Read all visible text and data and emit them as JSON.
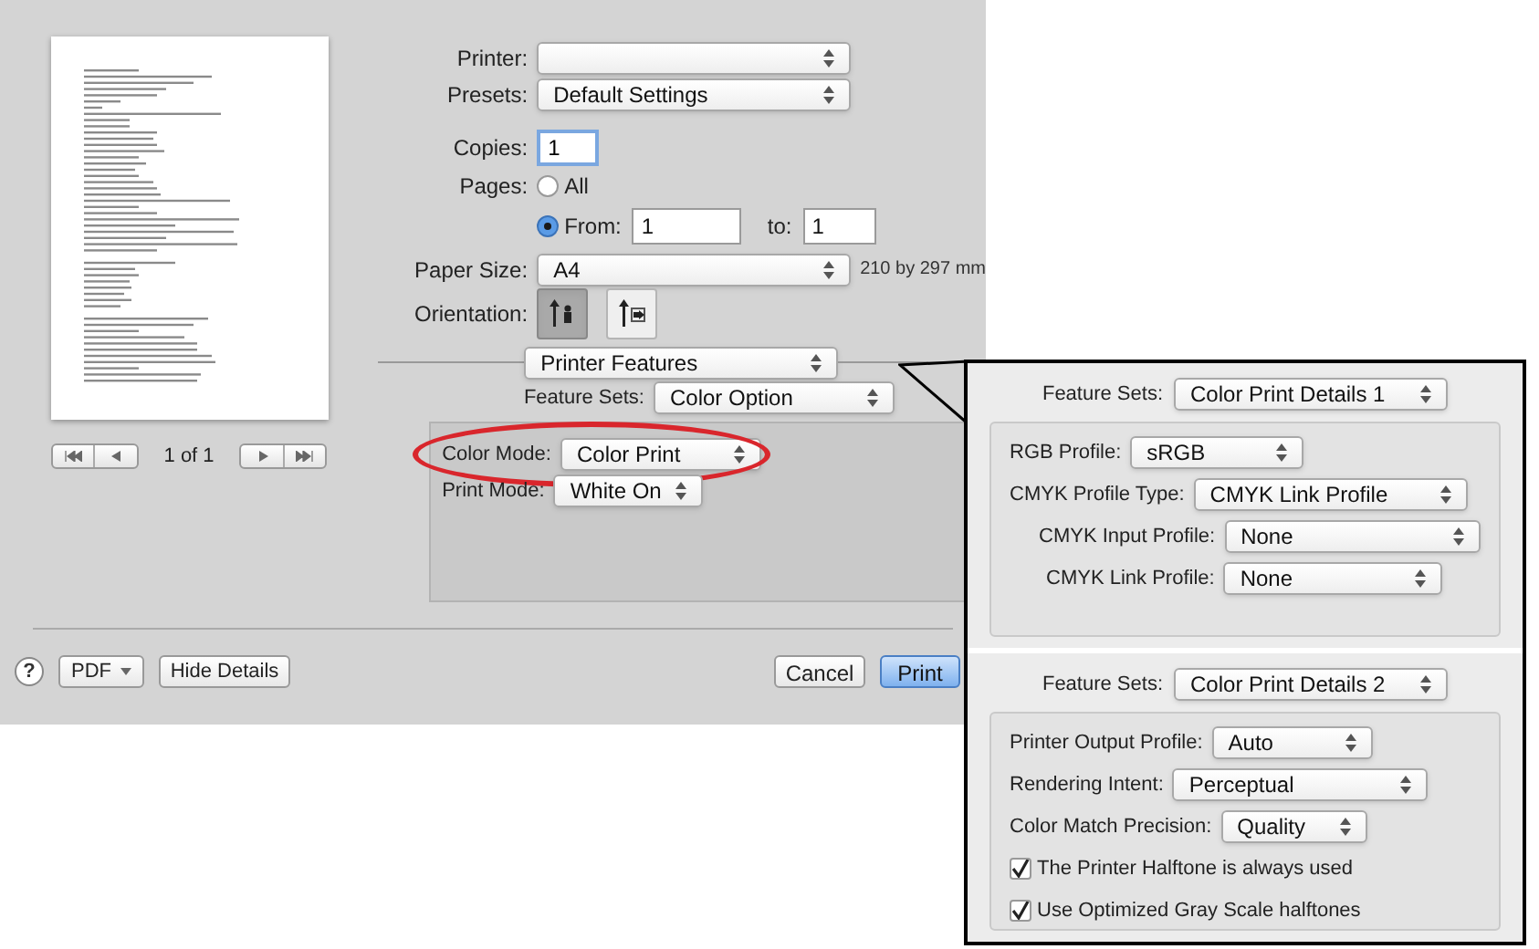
{
  "preview": {
    "page_indicator": "1 of 1"
  },
  "printer": {
    "label": "Printer:"
  },
  "presets": {
    "label": "Presets:",
    "value": "Default Settings"
  },
  "copies": {
    "label": "Copies:",
    "value": "1"
  },
  "pages": {
    "label": "Pages:",
    "options": [
      {
        "label": "All",
        "selected": false
      },
      {
        "label": "From:",
        "selected": true
      }
    ],
    "from": "1",
    "to_label": "to:",
    "to": "1"
  },
  "paper_size": {
    "label": "Paper Size:",
    "value": "A4",
    "dimensions": "210 by 297 mm"
  },
  "orientation": {
    "label": "Orientation:",
    "options": [
      {
        "kind": "portrait",
        "selected": true
      },
      {
        "kind": "landscape",
        "selected": false
      }
    ]
  },
  "panel_menu": {
    "value": "Printer Features"
  },
  "feature_sets": {
    "label": "Feature Sets:",
    "value": "Color Option"
  },
  "settings": [
    {
      "label": "Color Mode:",
      "value": "Color Print",
      "highlighted": true
    },
    {
      "label": "Print Mode:",
      "value": "White On",
      "highlighted": false
    }
  ],
  "footer": {
    "help": "?",
    "pdf": "PDF",
    "hide_details": "Hide Details",
    "cancel": "Cancel",
    "print": "Print"
  },
  "callout": [
    {
      "label": "Feature Sets:",
      "value": "Color Print Details 1",
      "rows": [
        {
          "kind": "popup",
          "label": "RGB Profile:",
          "value": "sRGB"
        },
        {
          "kind": "popup",
          "label": "CMYK Profile Type:",
          "value": "CMYK Link Profile"
        },
        {
          "kind": "popup",
          "label": "CMYK Input Profile:",
          "value": "None"
        },
        {
          "kind": "popup",
          "label": "CMYK Link Profile:",
          "value": "None"
        }
      ]
    },
    {
      "label": "Feature Sets:",
      "value": "Color Print Details 2",
      "rows": [
        {
          "kind": "popup",
          "label": "Printer Output Profile:",
          "value": "Auto"
        },
        {
          "kind": "popup",
          "label": "Rendering Intent:",
          "value": "Perceptual"
        },
        {
          "kind": "popup",
          "label": "Color Match Precision:",
          "value": "Quality"
        },
        {
          "kind": "checkbox",
          "label": "The Printer Halftone is always used",
          "checked": true
        },
        {
          "kind": "checkbox",
          "label": "Use Optimized Gray Scale halftones",
          "checked": true
        }
      ]
    }
  ]
}
